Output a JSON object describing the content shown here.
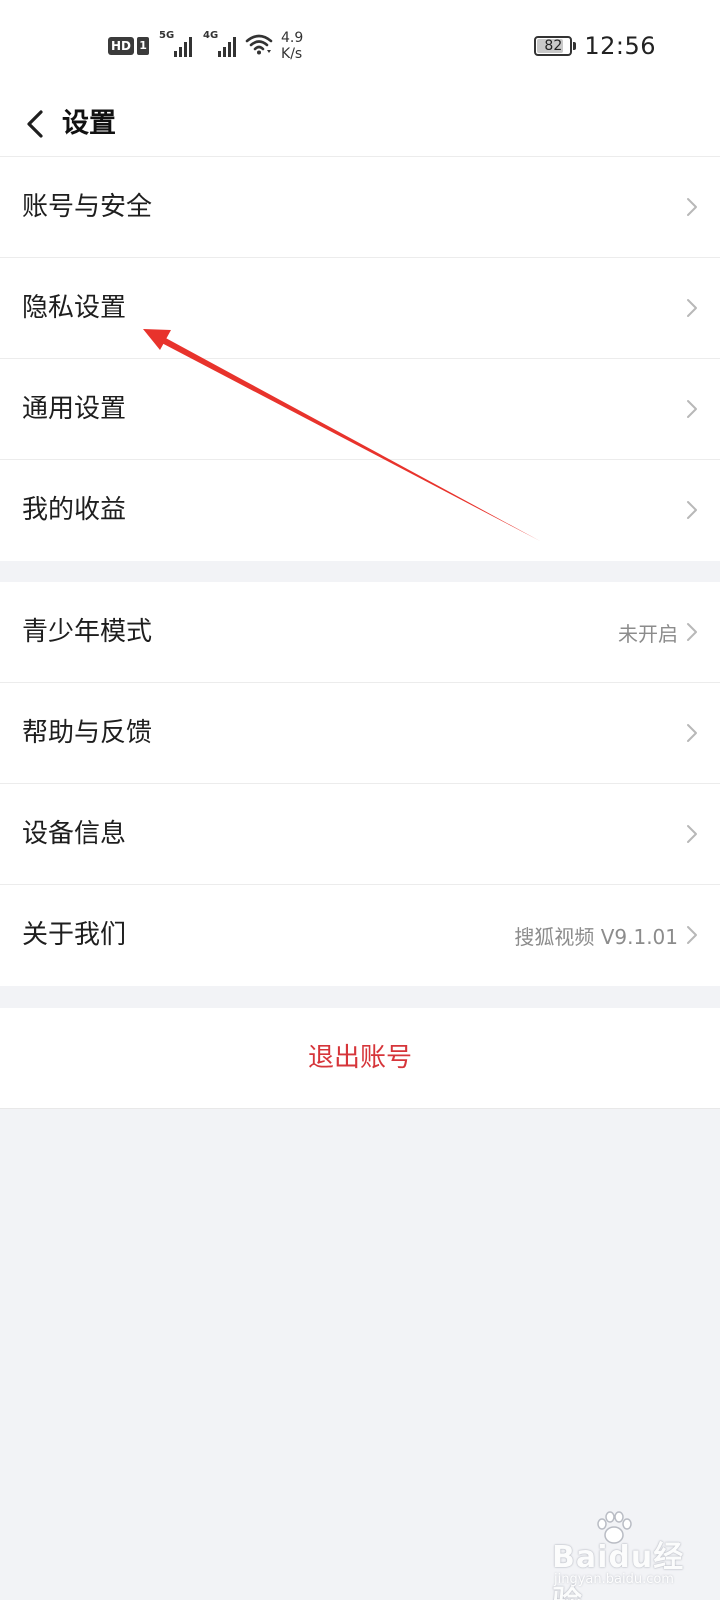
{
  "status_bar": {
    "hd_label": "HD",
    "sim_label": "1",
    "network_1": "5G",
    "network_2": "4G",
    "speed_value": "4.9",
    "speed_unit": "K/s",
    "battery_level": 82,
    "battery_text": "82",
    "time": "12:56",
    "icons": [
      "signal-icon",
      "wifi-icon",
      "battery-icon"
    ]
  },
  "header": {
    "title": "设置",
    "back_icon": "chevron-left-icon"
  },
  "groups": [
    {
      "items": [
        {
          "label": "账号与安全",
          "value": ""
        },
        {
          "label": "隐私设置",
          "value": ""
        },
        {
          "label": "通用设置",
          "value": ""
        },
        {
          "label": "我的收益",
          "value": ""
        }
      ]
    },
    {
      "items": [
        {
          "label": "青少年模式",
          "value": "未开启"
        },
        {
          "label": "帮助与反馈",
          "value": ""
        },
        {
          "label": "设备信息",
          "value": ""
        },
        {
          "label": "关于我们",
          "value": "搜狐视频 V9.1.01"
        }
      ]
    }
  ],
  "logout": {
    "label": "退出账号"
  },
  "colors": {
    "background": "#f2f3f6",
    "surface": "#ffffff",
    "logout_text": "#d6353a",
    "annotation_arrow": "#e8332c",
    "secondary_text": "#8c8c8c"
  },
  "watermark": {
    "text": "Baidu经验",
    "sub": "jingyan.baidu.com"
  }
}
